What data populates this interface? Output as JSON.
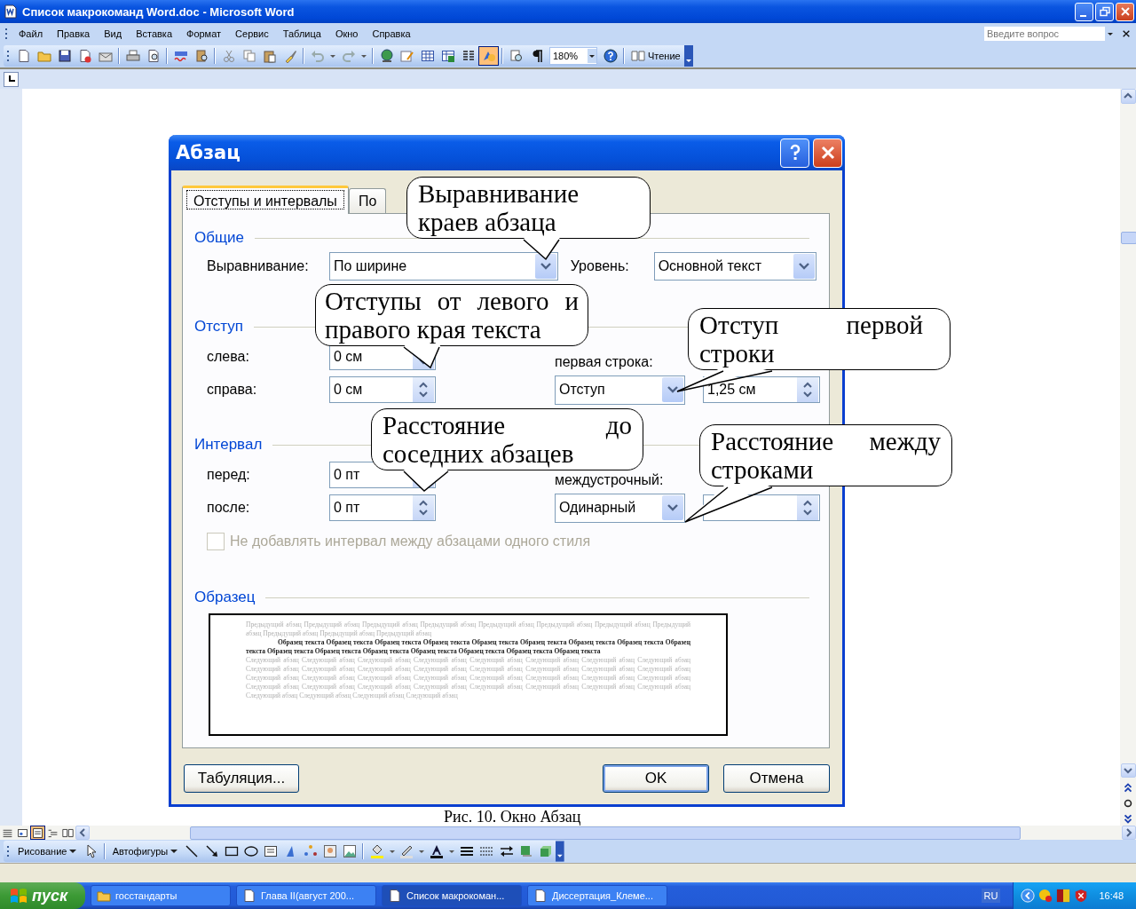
{
  "window": {
    "title": "Список макрокоманд Word.doc - Microsoft Word"
  },
  "menu": [
    "Файл",
    "Правка",
    "Вид",
    "Вставка",
    "Формат",
    "Сервис",
    "Таблица",
    "Окно",
    "Справка"
  ],
  "help_search": {
    "placeholder": "Введите вопрос"
  },
  "standard_toolbar": {
    "buttons": [
      {
        "pressed": false
      },
      {
        "pressed": false
      },
      {
        "pressed": false
      },
      {
        "pressed": false
      },
      {
        "pressed": false
      },
      {
        "pressed": false
      },
      {
        "pressed": false
      },
      {
        "pressed": false
      },
      {
        "pressed": false
      },
      {
        "pressed": false
      },
      {
        "pressed": false
      },
      {
        "pressed": false
      },
      {
        "pressed": false
      },
      {
        "pressed": false
      },
      {
        "pressed": false
      },
      {
        "pressed": false
      },
      {
        "pressed": false
      },
      {
        "pressed": false
      },
      {
        "pressed": false
      },
      {
        "pressed": false
      },
      {
        "pressed": false
      },
      {
        "pressed": false
      },
      {
        "pressed": true
      },
      {
        "pressed": false
      },
      {
        "pressed": false
      }
    ],
    "zoom": "180%",
    "reading": "Чтение"
  },
  "dialog": {
    "title": "Абзац",
    "tabs": [
      {
        "label": "Отступы и интервалы",
        "selected": true
      },
      {
        "label": "По",
        "selected": false
      }
    ],
    "general": {
      "heading": "Общие",
      "alignment_label": "Выравнивание:",
      "alignment": "По ширине",
      "outline_label": "Уровень:",
      "outline_value": "Основной текст"
    },
    "indent": {
      "heading": "Отступ",
      "left_label": "слева:",
      "left": "0 см",
      "right_label": "справа:",
      "right": "0 см",
      "first_line_label": "первая строка:",
      "first_line": "Отступ",
      "by": "1,25 см"
    },
    "spacing": {
      "heading": "Интервал",
      "before_label": "перед:",
      "before": "0 пт",
      "after_label": "после:",
      "after": "0 пт",
      "line_spacing_label": "междустрочный:",
      "line_spacing": "Одинарный"
    },
    "checkbox": {
      "label": "Не добавлять интервал между абзацами одного стиля",
      "checked": false,
      "disabled": true
    },
    "preview": {
      "heading": "Образец",
      "previous": "Предыдущий абзац Предыдущий абзац Предыдущий абзац Предыдущий абзац Предыдущий абзац Предыдущий абзац Предыдущий абзац Предыдущий абзац Предыдущий абзац Предыдущий абзац Предыдущий абзац",
      "sample": "Образец текста Образец текста Образец текста Образец текста Образец текста Образец текста Образец текста Образец текста Образец текста Образец текста Образец текста Образец текста Образец текста Образец текста Образец текста Образец текста",
      "next": "Следующий абзац Следующий абзац Следующий абзац Следующий абзац Следующий абзац Следующий абзац Следующий абзац Следующий абзац Следующий абзац Следующий абзац Следующий абзац Следующий абзац Следующий абзац Следующий абзац Следующий абзац Следующий абзац Следующий абзац Следующий абзац Следующий абзац Следующий абзац Следующий абзац Следующий абзац Следующий абзац Следующий абзац Следующий абзац Следующий абзац Следующий абзац Следующий абзац Следующий абзац Следующий абзац Следующий абзац Следующий абзац Следующий абзац Следующий абзац Следующий абзац Следующий абзац"
    },
    "buttons": {
      "tabs": "Табуляция...",
      "ok": "OK",
      "cancel": "Отмена"
    }
  },
  "callouts": [
    "Выравнивание краев абзаца",
    "Отступы от левого и правого края текста",
    "Отступ первой строки",
    "Расстояние до соседних абзацев",
    "Расстояние между строками"
  ],
  "document": {
    "caption": "Рис. 10. Окно Абзац"
  },
  "view_modes": [
    {
      "selected": false
    },
    {
      "selected": false
    },
    {
      "selected": true
    },
    {
      "selected": false
    },
    {
      "selected": false
    }
  ],
  "drawing_toolbar": {
    "menu": "Рисование",
    "autoshapes": "Автофигуры"
  },
  "taskbar": {
    "start": "пуск",
    "tasks": [
      {
        "label": "госстандарты",
        "kind": "folder",
        "selected": false
      },
      {
        "label": "Глава II(август 200...",
        "kind": "document",
        "selected": false
      },
      {
        "label": "Список макрокоман...",
        "kind": "document",
        "selected": true
      },
      {
        "label": "Диссертация_Клеме...",
        "kind": "document",
        "selected": false
      }
    ],
    "language": "RU",
    "clock": "16:48"
  }
}
